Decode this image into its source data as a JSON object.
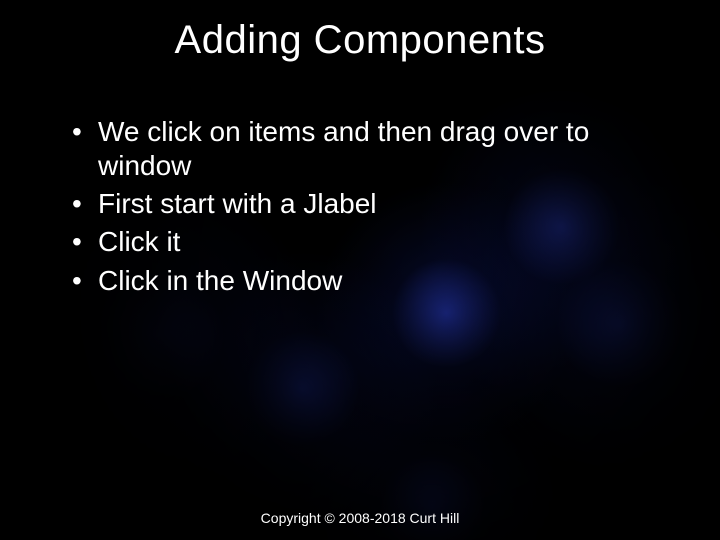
{
  "title": "Adding Components",
  "bullets": [
    "We click on items and then drag over to window",
    "First start with a Jlabel",
    "Click it",
    "Click in the Window"
  ],
  "footer": "Copyright © 2008-2018 Curt Hill"
}
